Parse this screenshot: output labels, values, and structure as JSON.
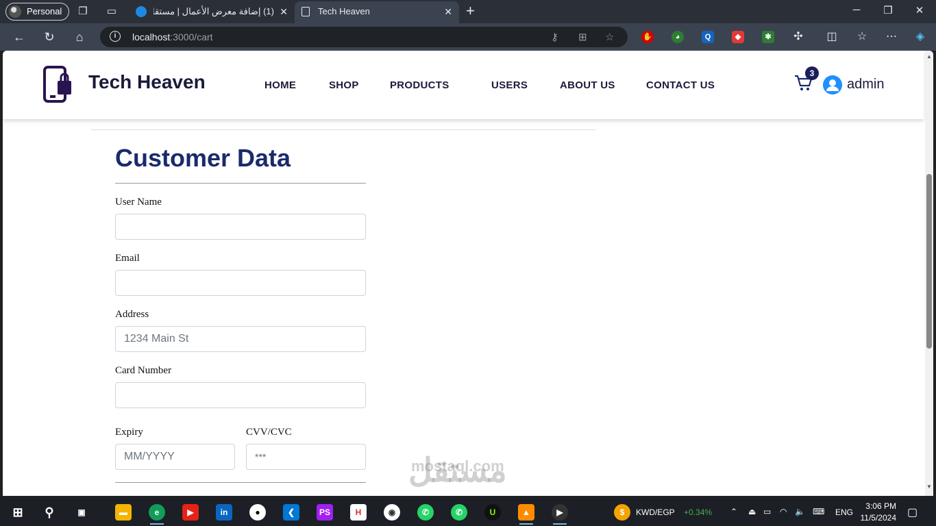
{
  "browser": {
    "profile_label": "Personal",
    "tabs": [
      {
        "title": "(1) إضافة معرض الأعمال | مستقل",
        "active": false
      },
      {
        "title": "Tech Heaven",
        "active": true
      }
    ],
    "url_host": "localhost",
    "url_path": ":3000/cart"
  },
  "site": {
    "brand": "Tech Heaven",
    "menu": [
      "HOME",
      "SHOP",
      "PRODUCTS",
      "USERS",
      "ABOUT US",
      "CONTACT US"
    ],
    "cart_count": "3",
    "user_name": "admin"
  },
  "form": {
    "title": "Customer Data",
    "fields": {
      "username": {
        "label": "User Name",
        "value": ""
      },
      "email": {
        "label": "Email",
        "value": ""
      },
      "address": {
        "label": "Address",
        "placeholder": "1234 Main St"
      },
      "card": {
        "label": "Card Number",
        "value": ""
      },
      "expiry": {
        "label": "Expiry",
        "placeholder": "MM/YYYY"
      },
      "cvv": {
        "label": "CVV/CVC",
        "placeholder": "***"
      }
    }
  },
  "watermark": "مستقل",
  "watermark_latin": "mostaql.com",
  "taskbar": {
    "ticker_label": "KWD/EGP",
    "ticker_value": "+0.34%",
    "lang": "ENG",
    "time": "3:06 PM",
    "date": "11/5/2024"
  },
  "colors": {
    "accent_navy": "#1a2a6c",
    "badge": "#1a1f5c",
    "user_icon": "#1e90ff"
  }
}
